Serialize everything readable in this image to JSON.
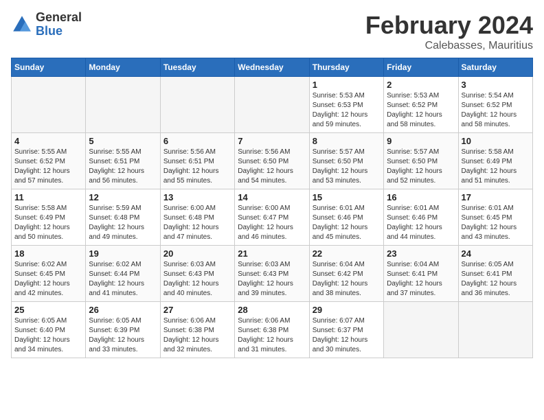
{
  "logo": {
    "general": "General",
    "blue": "Blue"
  },
  "title": "February 2024",
  "subtitle": "Calebasses, Mauritius",
  "days_header": [
    "Sunday",
    "Monday",
    "Tuesday",
    "Wednesday",
    "Thursday",
    "Friday",
    "Saturday"
  ],
  "weeks": [
    [
      {
        "num": "",
        "detail": ""
      },
      {
        "num": "",
        "detail": ""
      },
      {
        "num": "",
        "detail": ""
      },
      {
        "num": "",
        "detail": ""
      },
      {
        "num": "1",
        "detail": "Sunrise: 5:53 AM\nSunset: 6:53 PM\nDaylight: 12 hours\nand 59 minutes."
      },
      {
        "num": "2",
        "detail": "Sunrise: 5:53 AM\nSunset: 6:52 PM\nDaylight: 12 hours\nand 58 minutes."
      },
      {
        "num": "3",
        "detail": "Sunrise: 5:54 AM\nSunset: 6:52 PM\nDaylight: 12 hours\nand 58 minutes."
      }
    ],
    [
      {
        "num": "4",
        "detail": "Sunrise: 5:55 AM\nSunset: 6:52 PM\nDaylight: 12 hours\nand 57 minutes."
      },
      {
        "num": "5",
        "detail": "Sunrise: 5:55 AM\nSunset: 6:51 PM\nDaylight: 12 hours\nand 56 minutes."
      },
      {
        "num": "6",
        "detail": "Sunrise: 5:56 AM\nSunset: 6:51 PM\nDaylight: 12 hours\nand 55 minutes."
      },
      {
        "num": "7",
        "detail": "Sunrise: 5:56 AM\nSunset: 6:50 PM\nDaylight: 12 hours\nand 54 minutes."
      },
      {
        "num": "8",
        "detail": "Sunrise: 5:57 AM\nSunset: 6:50 PM\nDaylight: 12 hours\nand 53 minutes."
      },
      {
        "num": "9",
        "detail": "Sunrise: 5:57 AM\nSunset: 6:50 PM\nDaylight: 12 hours\nand 52 minutes."
      },
      {
        "num": "10",
        "detail": "Sunrise: 5:58 AM\nSunset: 6:49 PM\nDaylight: 12 hours\nand 51 minutes."
      }
    ],
    [
      {
        "num": "11",
        "detail": "Sunrise: 5:58 AM\nSunset: 6:49 PM\nDaylight: 12 hours\nand 50 minutes."
      },
      {
        "num": "12",
        "detail": "Sunrise: 5:59 AM\nSunset: 6:48 PM\nDaylight: 12 hours\nand 49 minutes."
      },
      {
        "num": "13",
        "detail": "Sunrise: 6:00 AM\nSunset: 6:48 PM\nDaylight: 12 hours\nand 47 minutes."
      },
      {
        "num": "14",
        "detail": "Sunrise: 6:00 AM\nSunset: 6:47 PM\nDaylight: 12 hours\nand 46 minutes."
      },
      {
        "num": "15",
        "detail": "Sunrise: 6:01 AM\nSunset: 6:46 PM\nDaylight: 12 hours\nand 45 minutes."
      },
      {
        "num": "16",
        "detail": "Sunrise: 6:01 AM\nSunset: 6:46 PM\nDaylight: 12 hours\nand 44 minutes."
      },
      {
        "num": "17",
        "detail": "Sunrise: 6:01 AM\nSunset: 6:45 PM\nDaylight: 12 hours\nand 43 minutes."
      }
    ],
    [
      {
        "num": "18",
        "detail": "Sunrise: 6:02 AM\nSunset: 6:45 PM\nDaylight: 12 hours\nand 42 minutes."
      },
      {
        "num": "19",
        "detail": "Sunrise: 6:02 AM\nSunset: 6:44 PM\nDaylight: 12 hours\nand 41 minutes."
      },
      {
        "num": "20",
        "detail": "Sunrise: 6:03 AM\nSunset: 6:43 PM\nDaylight: 12 hours\nand 40 minutes."
      },
      {
        "num": "21",
        "detail": "Sunrise: 6:03 AM\nSunset: 6:43 PM\nDaylight: 12 hours\nand 39 minutes."
      },
      {
        "num": "22",
        "detail": "Sunrise: 6:04 AM\nSunset: 6:42 PM\nDaylight: 12 hours\nand 38 minutes."
      },
      {
        "num": "23",
        "detail": "Sunrise: 6:04 AM\nSunset: 6:41 PM\nDaylight: 12 hours\nand 37 minutes."
      },
      {
        "num": "24",
        "detail": "Sunrise: 6:05 AM\nSunset: 6:41 PM\nDaylight: 12 hours\nand 36 minutes."
      }
    ],
    [
      {
        "num": "25",
        "detail": "Sunrise: 6:05 AM\nSunset: 6:40 PM\nDaylight: 12 hours\nand 34 minutes."
      },
      {
        "num": "26",
        "detail": "Sunrise: 6:05 AM\nSunset: 6:39 PM\nDaylight: 12 hours\nand 33 minutes."
      },
      {
        "num": "27",
        "detail": "Sunrise: 6:06 AM\nSunset: 6:38 PM\nDaylight: 12 hours\nand 32 minutes."
      },
      {
        "num": "28",
        "detail": "Sunrise: 6:06 AM\nSunset: 6:38 PM\nDaylight: 12 hours\nand 31 minutes."
      },
      {
        "num": "29",
        "detail": "Sunrise: 6:07 AM\nSunset: 6:37 PM\nDaylight: 12 hours\nand 30 minutes."
      },
      {
        "num": "",
        "detail": ""
      },
      {
        "num": "",
        "detail": ""
      }
    ]
  ]
}
